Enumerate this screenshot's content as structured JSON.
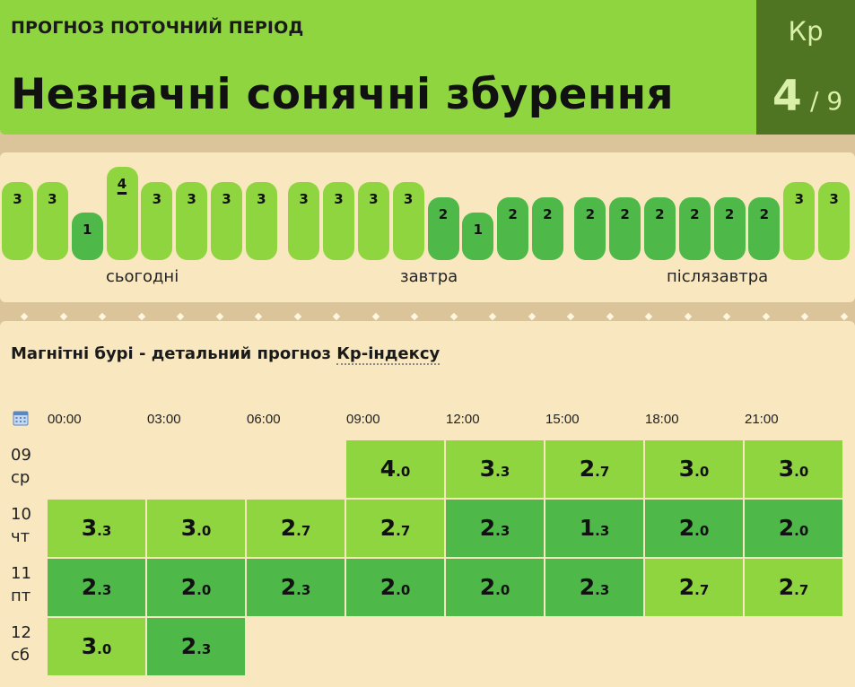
{
  "header": {
    "label": "ПРОГНОЗ ПОТОЧНИЙ ПЕРІОД",
    "title": "Незначні сонячні збурення",
    "kp_label": "Кр",
    "kp_value": "4",
    "kp_max": "/ 9",
    "color": "#8ed53f",
    "kp_box_color": "#4f7522"
  },
  "bars": {
    "colors": {
      "1": "#4eb849",
      "2": "#4eb849",
      "3": "#8ed53f",
      "4": "#8ed53f"
    },
    "current_index": 3,
    "values": [
      3,
      3,
      1,
      4,
      3,
      3,
      3,
      3,
      3,
      3,
      3,
      3,
      2,
      1,
      2,
      2,
      2,
      2,
      2,
      2,
      2,
      2,
      3,
      3
    ],
    "day_labels": [
      "сьогодні",
      "завтра",
      "післязавтра"
    ]
  },
  "detail": {
    "title_prefix": "Магнітні бурі - детальний прогноз ",
    "title_link": "Кр-індексу",
    "calendar_icon": "calendar-icon",
    "times": [
      "00:00",
      "03:00",
      "06:00",
      "09:00",
      "12:00",
      "15:00",
      "18:00",
      "21:00"
    ],
    "rows": [
      {
        "day": "09",
        "weekday": "ср",
        "cells": [
          null,
          null,
          null,
          "4.0",
          "3.3",
          "2.7",
          "3.0",
          "3.0"
        ]
      },
      {
        "day": "10",
        "weekday": "чт",
        "cells": [
          "3.3",
          "3.0",
          "2.7",
          "2.7",
          "2.3",
          "1.3",
          "2.0",
          "2.0"
        ]
      },
      {
        "day": "11",
        "weekday": "пт",
        "cells": [
          "2.3",
          "2.0",
          "2.3",
          "2.0",
          "2.0",
          "2.3",
          "2.7",
          "2.7"
        ]
      },
      {
        "day": "12",
        "weekday": "сб",
        "cells": [
          "3.0",
          "2.3",
          null,
          null,
          null,
          null,
          null,
          null
        ]
      }
    ],
    "level_colors": {
      "low": "#4eb849",
      "mid": "#8ed53f"
    }
  }
}
